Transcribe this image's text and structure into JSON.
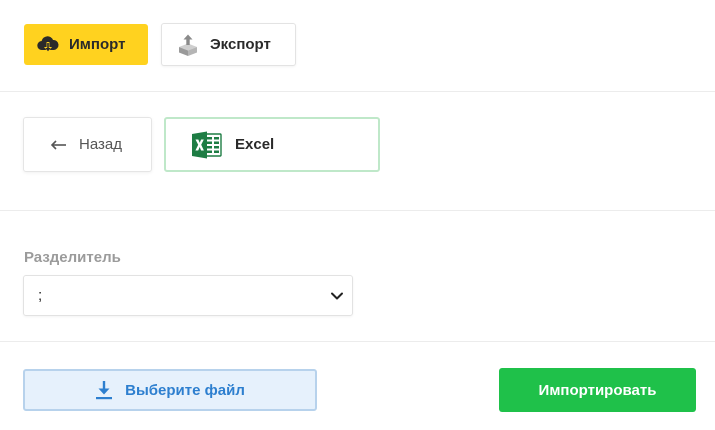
{
  "tabs": {
    "import_label": "Импорт",
    "export_label": "Экспорт"
  },
  "format_row": {
    "back_label": "Назад",
    "excel_label": "Excel"
  },
  "separator": {
    "label": "Разделитель",
    "selected_value": ";"
  },
  "actions": {
    "choose_file_label": "Выберите файл",
    "import_label": "Импортировать"
  },
  "icons": {
    "import": "cloud-download-icon",
    "export": "box-upload-icon",
    "back": "arrow-left-icon",
    "excel": "excel-icon",
    "select": "chevron-down-icon",
    "file": "download-icon"
  },
  "colors": {
    "import_tab_bg": "#ffd21f",
    "excel_border": "#bfe8c9",
    "file_button_bg": "#e6f1fc",
    "file_button_text": "#2d7fcf",
    "import_button_bg": "#1fc14a"
  }
}
